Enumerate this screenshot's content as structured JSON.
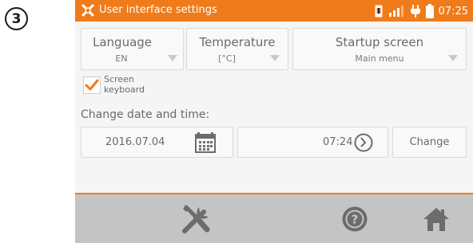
{
  "step_badge": "3",
  "statusbar": {
    "title": "User interface settings",
    "time": "07:25",
    "icons": [
      "settings-icon",
      "sim-card-icon",
      "signal-icon",
      "power-plug-icon",
      "battery-icon"
    ]
  },
  "settings": {
    "language": {
      "label": "Language",
      "value": "EN"
    },
    "temperature": {
      "label": "Temperature",
      "value": "[°C]"
    },
    "startup": {
      "label": "Startup screen",
      "value": "Main menu"
    }
  },
  "screen_keyboard": {
    "label_line1": "Screen",
    "label_line2": "keyboard",
    "checked": true
  },
  "datetime": {
    "section_title": "Change date and time:",
    "date": "2016.07.04",
    "time": "07:24",
    "change_label": "Change"
  },
  "footer": {
    "buttons": [
      "tools-icon",
      "help-icon",
      "home-icon"
    ]
  },
  "colors": {
    "accent": "#f07b1b",
    "footer": "#c4c4c4",
    "icon_gray": "#6c6c6c"
  }
}
